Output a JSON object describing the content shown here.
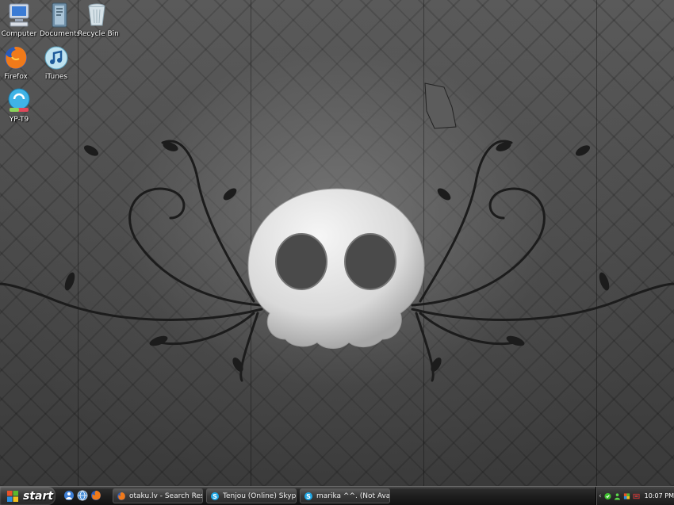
{
  "desktop": {
    "icons": [
      {
        "label": "Computer"
      },
      {
        "label": "Documents"
      },
      {
        "label": "Recycle Bin"
      },
      {
        "label": "Firefox"
      },
      {
        "label": "iTunes"
      },
      {
        "label": "YP-T9"
      }
    ]
  },
  "taskbar": {
    "start_label": "start",
    "quick_launch": [
      {
        "icon": "messenger-icon"
      },
      {
        "icon": "globe-icon"
      },
      {
        "icon": "firefox-icon"
      }
    ],
    "tasks": [
      {
        "label": "otaku.lv - Search Res...",
        "icon": "firefox-icon"
      },
      {
        "label": "Tenjou (Online) Skyp...",
        "icon": "skype-icon"
      },
      {
        "label": "marika ^^. (Not Avail...",
        "icon": "skype-icon"
      }
    ],
    "tray": {
      "clock": "10:07 PM"
    }
  },
  "colors": {
    "taskbar": "#1d1d1d",
    "skull": "#e6e6e6",
    "accent_green": "#3fbf2f"
  }
}
